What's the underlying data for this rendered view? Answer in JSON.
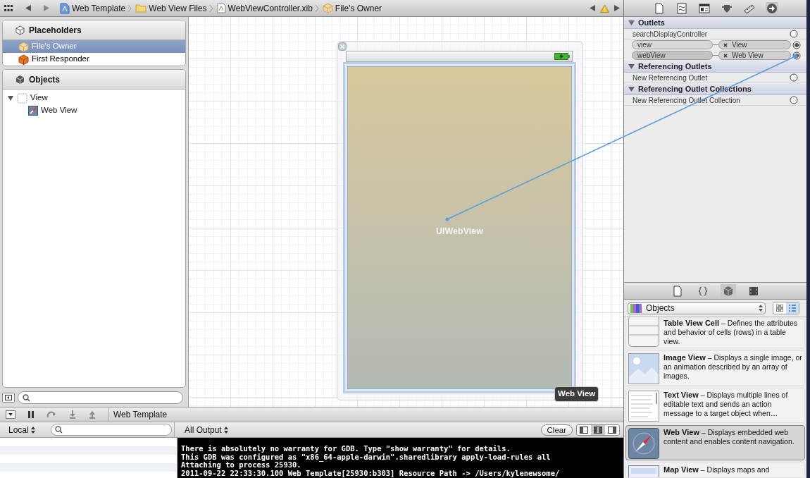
{
  "toolbar": {
    "breadcrumbs": [
      {
        "label": "Web Template",
        "kind": "project"
      },
      {
        "label": "Web View Files",
        "kind": "folder"
      },
      {
        "label": "WebViewController.xib",
        "kind": "xib"
      },
      {
        "label": "File's Owner",
        "kind": "owner"
      }
    ]
  },
  "placeholders": {
    "title": "Placeholders",
    "items": [
      {
        "label": "File's Owner",
        "kind": "owner",
        "selected": true
      },
      {
        "label": "First Responder",
        "kind": "responder",
        "selected": false
      }
    ]
  },
  "objects": {
    "title": "Objects",
    "tree": [
      {
        "label": "View",
        "kind": "view",
        "expanded": true,
        "children": [
          {
            "label": "Web View",
            "kind": "webview"
          }
        ]
      }
    ]
  },
  "inspector_tabs": [
    {
      "selected": false
    },
    {
      "selected": false
    },
    {
      "selected": false
    },
    {
      "selected": false
    },
    {
      "selected": false
    },
    {
      "selected": true
    }
  ],
  "library_tabs": [
    {
      "selected": false
    },
    {
      "selected": false
    },
    {
      "selected": true
    },
    {
      "selected": false
    }
  ],
  "canvas": {
    "view_label": "UIWebView",
    "tooltip": "Web View"
  },
  "connections_inspector": {
    "sections": [
      {
        "title": "Outlets",
        "rows": [
          {
            "name": "searchDisplayController",
            "connected": false
          },
          {
            "name": "view",
            "target": "View",
            "connected": true
          },
          {
            "name": "webView",
            "target": "Web View",
            "connected": true
          }
        ]
      },
      {
        "title": "Referencing Outlets",
        "rows": [
          {
            "name": "New Referencing Outlet",
            "connected": false
          }
        ]
      },
      {
        "title": "Referencing Outlet Collections",
        "rows": [
          {
            "name": "New Referencing Outlet Collection",
            "connected": false
          }
        ]
      }
    ]
  },
  "library": {
    "filter": "Objects",
    "items": [
      {
        "title": "Table View Cell",
        "description": "– Defines the attributes and behavior of cells (rows) in a table view.",
        "kind": "cell",
        "selected": false
      },
      {
        "title": "Image View",
        "description": "– Displays a single image, or an animation described by an array of images.",
        "kind": "image",
        "selected": false
      },
      {
        "title": "Text View",
        "description": "– Displays multiple lines of editable text and sends an action message to a target object when…",
        "kind": "text",
        "selected": false
      },
      {
        "title": "Web View",
        "description": "– Displays embedded web content and enables content navigation.",
        "kind": "web",
        "selected": true
      },
      {
        "title": "Map View",
        "description": "– Displays maps and",
        "kind": "map",
        "selected": false
      }
    ]
  },
  "debug_bar": {
    "scheme": "Web Template"
  },
  "debug_area": {
    "scope": "Local",
    "output_filter": "All Output",
    "clear_button": "Clear",
    "console_lines": [
      "There is absolutely no warranty for GDB.  Type \"show warranty\" for details.",
      "This GDB was configured as \"x86_64-apple-darwin\".sharedlibrary apply-load-rules all",
      "Attaching to process 25930.",
      "2011-09-22 22:33:30.100 Web Template[25930:b303] Resource Path -> /Users/kylenewsome/"
    ]
  }
}
